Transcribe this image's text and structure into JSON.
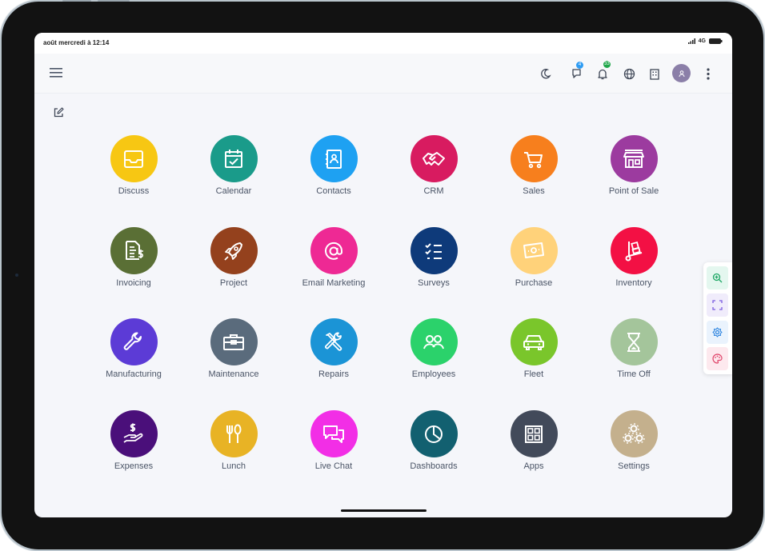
{
  "status_bar": {
    "time": "août mercredi à 12:14",
    "network": "4G"
  },
  "topbar": {
    "chat_badge": "4",
    "activity_badge": "33"
  },
  "colors": {
    "chat_badge": "#2e9cf3",
    "activity_badge": "#1fa64a",
    "avatar": "#8b7fa8"
  },
  "apps": [
    {
      "label": "Discuss",
      "color": "#f7c713",
      "icon": "inbox-icon"
    },
    {
      "label": "Calendar",
      "color": "#1a9b8a",
      "icon": "calendar-icon"
    },
    {
      "label": "Contacts",
      "color": "#1ea1f2",
      "icon": "contacts-book-icon"
    },
    {
      "label": "CRM",
      "color": "#d81b60",
      "icon": "handshake-icon"
    },
    {
      "label": "Sales",
      "color": "#f77f1d",
      "icon": "shopping-cart-icon"
    },
    {
      "label": "Point of Sale",
      "color": "#9c3b9f",
      "icon": "store-icon"
    },
    {
      "label": "Invoicing",
      "color": "#5a6f35",
      "icon": "invoice-icon"
    },
    {
      "label": "Project",
      "color": "#94411d",
      "icon": "rocket-icon"
    },
    {
      "label": "Email Marketing",
      "color": "#ee2994",
      "icon": "at-sign-icon"
    },
    {
      "label": "Surveys",
      "color": "#0e3a7a",
      "icon": "checklist-icon"
    },
    {
      "label": "Purchase",
      "color": "#ffd27a",
      "icon": "banknote-icon"
    },
    {
      "label": "Inventory",
      "color": "#f31044",
      "icon": "dolly-icon"
    },
    {
      "label": "Manufacturing",
      "color": "#5c3bd6",
      "icon": "wrench-icon"
    },
    {
      "label": "Maintenance",
      "color": "#5a6b7c",
      "icon": "toolbox-icon"
    },
    {
      "label": "Repairs",
      "color": "#1b94d6",
      "icon": "tools-icon"
    },
    {
      "label": "Employees",
      "color": "#2bd26b",
      "icon": "people-icon"
    },
    {
      "label": "Fleet",
      "color": "#7ac62b",
      "icon": "car-icon"
    },
    {
      "label": "Time Off",
      "color": "#a4c59b",
      "icon": "hourglass-icon"
    },
    {
      "label": "Expenses",
      "color": "#4a0f7a",
      "icon": "money-hand-icon"
    },
    {
      "label": "Lunch",
      "color": "#e8b325",
      "icon": "fork-spoon-icon"
    },
    {
      "label": "Live Chat",
      "color": "#f22ee6",
      "icon": "chat-bubbles-icon"
    },
    {
      "label": "Dashboards",
      "color": "#126070",
      "icon": "pie-chart-icon"
    },
    {
      "label": "Apps",
      "color": "#424a5a",
      "icon": "grid-icon"
    },
    {
      "label": "Settings",
      "color": "#c4b08d",
      "icon": "gears-icon"
    }
  ]
}
